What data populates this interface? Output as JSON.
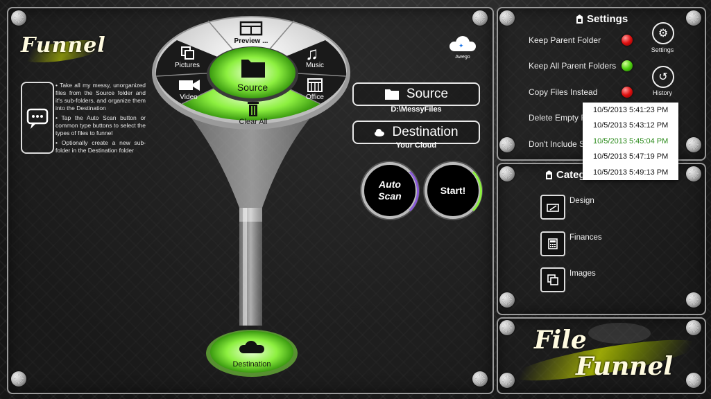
{
  "app": {
    "logo": "Funnel"
  },
  "help": {
    "items": [
      "• Take all my messy, unorganized files from the Source folder and it's sub-folders, and organize them into the Destination",
      "• Tap the Auto Scan button or common type buttons to select the types of files to funnel",
      "• Optionally create a new sub-folder in the Destination folder"
    ]
  },
  "funnel": {
    "segments": {
      "preview": "Preview ...",
      "pictures": "Pictures",
      "music": "Music",
      "video": "Video",
      "office": "Office",
      "source": "Source",
      "clear_all": "Clear All"
    },
    "destination_label": "Destination"
  },
  "cloud": {
    "label": "Awego"
  },
  "source": {
    "button_label": "Source",
    "path": "D:\\MessyFiles"
  },
  "destination": {
    "button_label": "Destination",
    "path": "Your Cloud"
  },
  "actions": {
    "auto_scan_line1": "Auto",
    "auto_scan_line2": "Scan",
    "start": "Start!"
  },
  "settings": {
    "title": "Settings",
    "rows": [
      {
        "label": "Keep Parent Folder",
        "status": "red"
      },
      {
        "label": "Keep All Parent Folders",
        "status": "green"
      },
      {
        "label": "Copy Files Instead",
        "status": "red"
      },
      {
        "label": "Delete Empty Fo"
      },
      {
        "label": "Don't Include Su"
      }
    ],
    "settings_button": "Settings",
    "history_button": "History"
  },
  "history": {
    "entries": [
      "10/5/2013 5:41:23 PM",
      "10/5/2013 5:43:12 PM",
      "10/5/2013 5:45:04 PM",
      "10/5/2013 5:47:19 PM",
      "10/5/2013 5:49:13 PM"
    ],
    "selected_index": 2
  },
  "categories": {
    "title": "Categ",
    "items": [
      {
        "label": "Design",
        "icon": "design-icon"
      },
      {
        "label": "Finances",
        "icon": "calculator-icon"
      },
      {
        "label": "Images",
        "icon": "images-icon"
      }
    ]
  },
  "brand": {
    "line1": "File",
    "line2": "Funnel"
  },
  "colors": {
    "accent_green": "#7cff3a",
    "led_red": "#e01010",
    "led_green": "#4fd010"
  }
}
